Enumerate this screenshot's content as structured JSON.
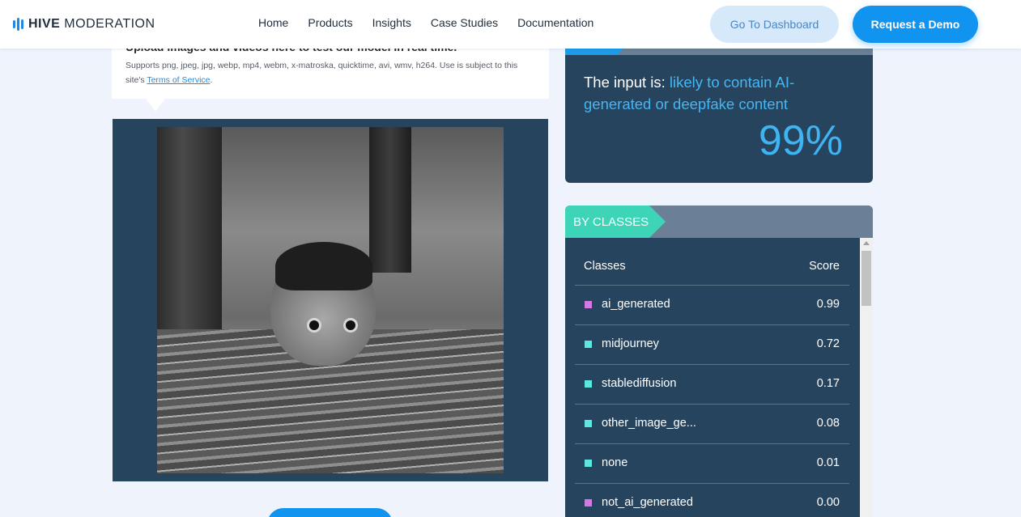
{
  "nav": {
    "logo_bold": "HIVE",
    "logo_light": " MODERATION",
    "links": [
      "Home",
      "Products",
      "Insights",
      "Case Studies",
      "Documentation"
    ],
    "dashboard_label": "Go To Dashboard",
    "demo_label": "Request a Demo"
  },
  "upload": {
    "title": "Upload images and videos here to test our model in real time.",
    "desc": "Supports png, jpeg, jpg, webp, mp4, webm, x-matroska, quicktime, avi, wmv, h264. Use is subject to this site's ",
    "terms_link": "Terms of Service",
    "desc_end": "."
  },
  "result": {
    "prefix": "The input is: ",
    "verdict": "likely to contain AI-generated or deepfake content",
    "percent": "99%"
  },
  "classes": {
    "tag": "BY CLASSES",
    "col_classes": "Classes",
    "col_score": "Score",
    "rows": [
      {
        "name": "ai_generated",
        "score": "0.99",
        "color": "#d07ae6"
      },
      {
        "name": "midjourney",
        "score": "0.72",
        "color": "#5ee6e0"
      },
      {
        "name": "stablediffusion",
        "score": "0.17",
        "color": "#5ee6e0"
      },
      {
        "name": "other_image_ge...",
        "score": "0.08",
        "color": "#5ee6e0"
      },
      {
        "name": "none",
        "score": "0.01",
        "color": "#5ee6e0"
      },
      {
        "name": "not_ai_generated",
        "score": "0.00",
        "color": "#d07ae6"
      }
    ]
  },
  "colors": {
    "accent": "#1193f0",
    "panel": "#27445e",
    "highlight": "#44b6f3",
    "tag_teal": "#3dd4b8"
  }
}
